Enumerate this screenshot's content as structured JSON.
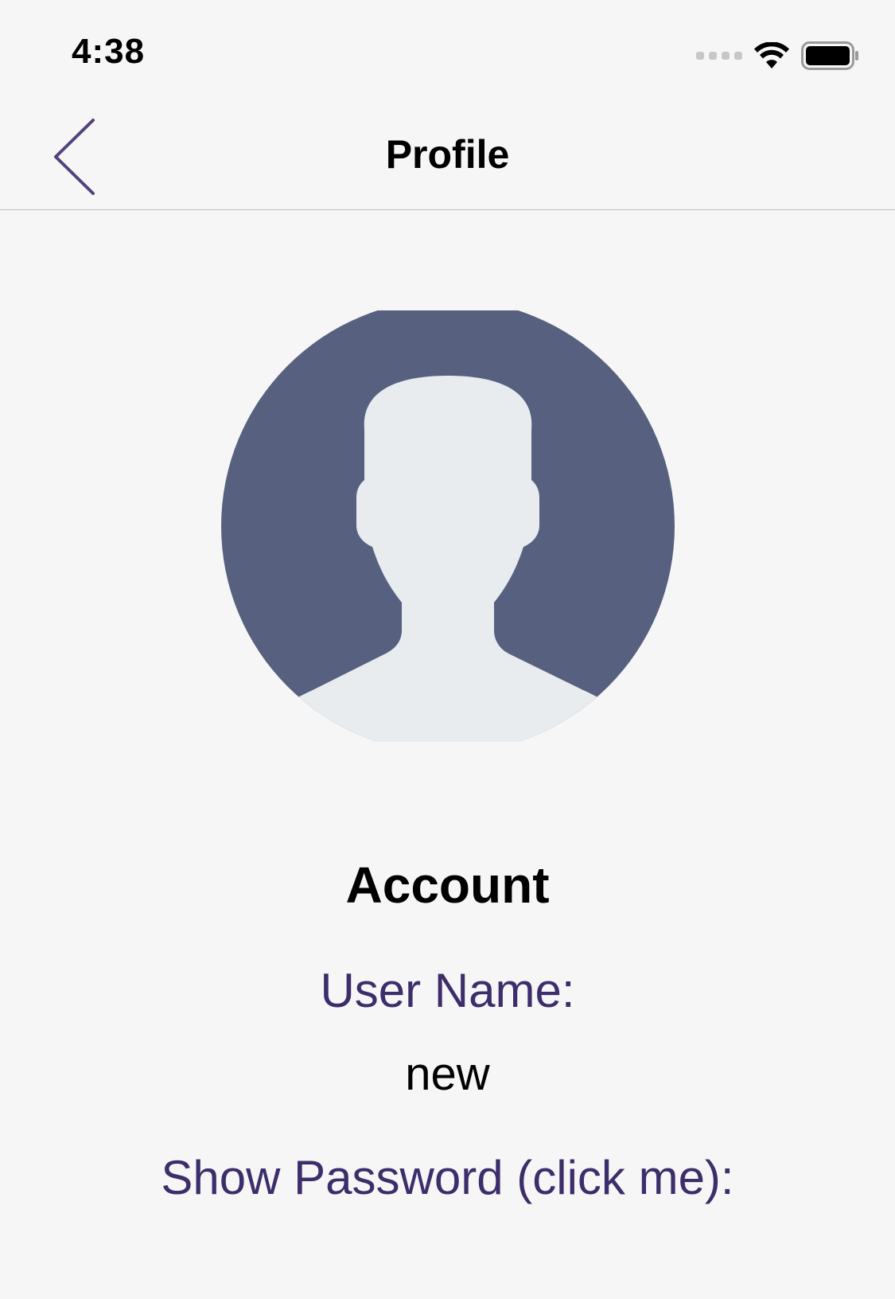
{
  "status_bar": {
    "time": "4:38",
    "icons": [
      "cellular-dots-icon",
      "wifi-icon",
      "battery-icon"
    ]
  },
  "nav": {
    "back_icon": "chevron-left-icon",
    "title": "Profile"
  },
  "avatar": {
    "icon": "user-silhouette-icon",
    "colors": {
      "circle": "#57607f",
      "figure": "#e8ecee"
    }
  },
  "account": {
    "section_title": "Account",
    "username_label": "User Name:",
    "username_value": "new",
    "show_password_label": "Show Password (click me):"
  },
  "colors": {
    "accent": "#3e2d6b",
    "back_chevron": "#54407f",
    "background": "#f6f6f6"
  }
}
